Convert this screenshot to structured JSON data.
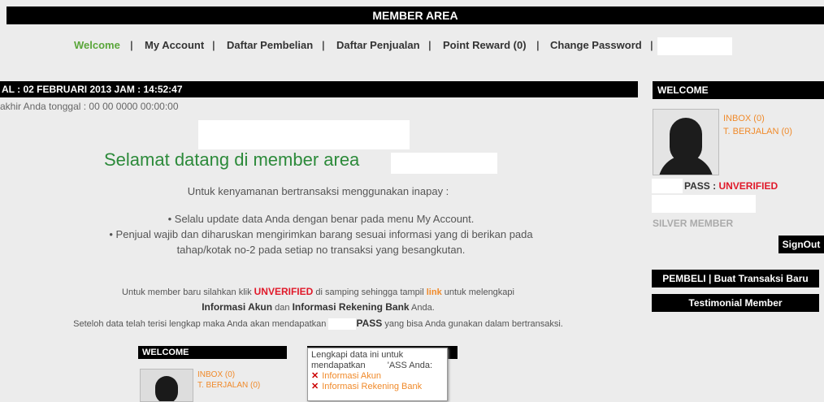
{
  "header": {
    "title": "MEMBER AREA"
  },
  "nav": {
    "welcome": "Welcome",
    "my_account": "My Account",
    "daftar_pembelian": "Daftar Pembelian",
    "daftar_penjualan": "Daftar Penjualan",
    "point_reward": "Point Reward (0)",
    "change_password": "Change Password",
    "separator": "|"
  },
  "main": {
    "date_bar": "AL : 02 FEBRUARI 2013 JAM : 14:52:47",
    "last_login": "akhir Anda tonggal : 00 00 0000 00:00:00",
    "welcome_title": "Selamat datang di member area",
    "intro": "Untuk kenyamanan bertransaksi menggunakan inapay :",
    "bullet1": "• Selalu update data Anda dengan benar pada menu My Account.",
    "bullet2": "• Penjual wajib dan diharuskan mengirimkan barang sesuai informasi yang di berikan pada tahap/kotak no-2 pada setiap no transaksi yang besangkutan.",
    "info1_pre": "Untuk member baru silahkan klik ",
    "info1_unverified": "UNVERIFIED",
    "info1_mid": " di samping sehingga tampil ",
    "info1_link": "link",
    "info1_post": " untuk melengkapi",
    "info2_akun": "Informasi Akun",
    "info2_dan": " dan ",
    "info2_bank": "Informasi Rekening Bank",
    "info2_post": " Anda.",
    "info3_pre": "Seteloh data telah terisi lengkap maka Anda akan mendapatkan ",
    "info3_pass": "PASS",
    "info3_post": " yang bisa Anda gunakan dalam bertransaksi."
  },
  "preview": {
    "welcome": "WELCOME",
    "inbox": "INBOX (0)",
    "berjalan": "T. BERJALAN (0)",
    "tooltip_line1": "Lengkapi data ini untuk",
    "tooltip_line2_pre": "mendapatkan ",
    "tooltip_line2_post": "'ASS Anda:",
    "tooltip_item1": "Informasi Akun",
    "tooltip_item2": "Informasi Rekening Bank"
  },
  "sidebar": {
    "title": "WELCOME",
    "inbox": "INBOX (0)",
    "berjalan": "T. BERJALAN (0)",
    "pass_label": "PASS : ",
    "pass_status": "UNVERIFIED",
    "member_level": "SILVER MEMBER",
    "signout": "SignOut",
    "buat_transaksi": "PEMBELI | Buat Transaksi Baru",
    "testimonial": "Testimonial Member"
  },
  "colors": {
    "accent_green": "#2c8a3a",
    "nav_active": "#5aa63a",
    "link_orange": "#f08a2a",
    "alert_red": "#e0192a"
  }
}
